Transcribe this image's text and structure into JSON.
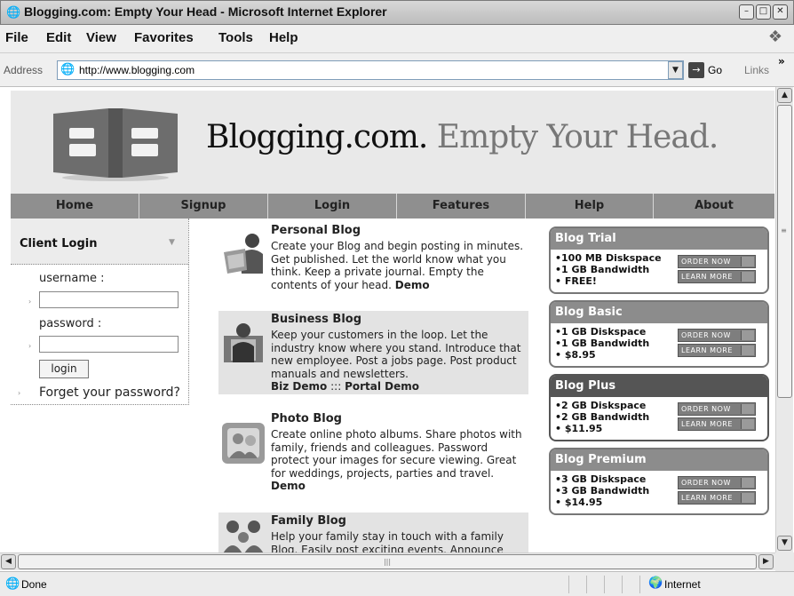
{
  "window": {
    "title": "Blogging.com: Empty Your Head - Microsoft Internet Explorer",
    "app_icon": "ie-icon",
    "controls": [
      "minimize",
      "maximize",
      "close"
    ]
  },
  "menu": [
    "File",
    "Edit",
    "View",
    "Favorites",
    "Tools",
    "Help"
  ],
  "address": {
    "label": "Address",
    "url": "http://www.blogging.com",
    "go_label": "Go",
    "links_label": "Links"
  },
  "site": {
    "name": "Blogging.com.",
    "tagline": "Empty Your Head."
  },
  "nav": [
    "Home",
    "Signup",
    "Login",
    "Features",
    "Help",
    "About"
  ],
  "login": {
    "title": "Client Login",
    "username_label": "username :",
    "username_value": "",
    "password_label": "password :",
    "password_value": "",
    "button": "login",
    "forgot": "Forget your password?"
  },
  "blogs": [
    {
      "title": "Personal Blog",
      "desc": "Create your Blog and begin posting in minutes. Get published. Let the world know what you think. Keep a private journal. Empty the contents of your head.",
      "link1": "Demo"
    },
    {
      "title": "Business Blog",
      "desc": "Keep your customers in the loop. Let the industry know where you stand. Introduce that new employee. Post a jobs page. Post product manuals and newsletters.",
      "link1": "Biz Demo",
      "sep": ":::",
      "link2": "Portal Demo"
    },
    {
      "title": "Photo Blog",
      "desc": "Create online photo albums. Share photos with family, friends and colleagues. Password protect your images for secure viewing. Great for weddings, projects, parties and travel.",
      "link1": "Demo"
    },
    {
      "title": "Family Blog",
      "desc": "Help your family stay in touch with a family Blog. Easily post exciting events. Announce"
    }
  ],
  "plans": [
    {
      "name": "Blog Trial",
      "features": [
        "•100 MB Diskspace",
        "•1 GB Bandwidth",
        "• FREE!"
      ],
      "order": "ORDER NOW",
      "learn": "LEARN MORE"
    },
    {
      "name": "Blog Basic",
      "features": [
        "•1 GB Diskspace",
        "•1 GB Bandwidth",
        "• $8.95"
      ],
      "order": "ORDER NOW",
      "learn": "LEARN MORE"
    },
    {
      "name": "Blog Plus",
      "features": [
        "•2 GB Diskspace",
        "•2 GB Bandwidth",
        "• $11.95"
      ],
      "order": "ORDER NOW",
      "learn": "LEARN MORE"
    },
    {
      "name": "Blog Premium",
      "features": [
        "•3 GB Diskspace",
        "•3 GB Bandwidth",
        "• $14.95"
      ],
      "order": "ORDER NOW",
      "learn": "LEARN MORE"
    }
  ],
  "status": {
    "text": "Done",
    "zone": "Internet"
  }
}
